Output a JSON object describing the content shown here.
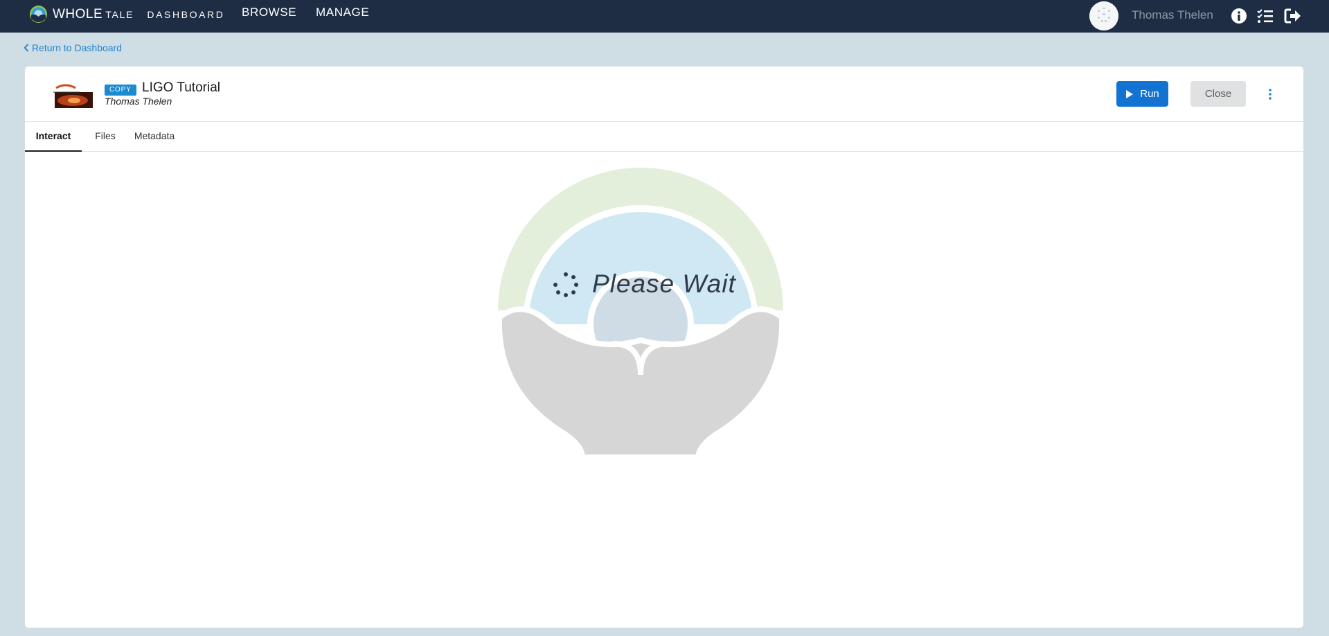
{
  "topbar": {
    "brand_whole": "WHOLE",
    "brand_tale": "TALE",
    "brand_dashboard": "DASHBOARD",
    "nav": [
      {
        "label": "BROWSE"
      },
      {
        "label": "MANAGE"
      }
    ],
    "username": "Thomas Thelen",
    "icons": [
      "info-icon",
      "tasks-icon",
      "logout-icon"
    ]
  },
  "return_link": {
    "label": "Return to Dashboard"
  },
  "tale": {
    "badge": "COPY",
    "title": "LIGO Tutorial",
    "author": "Thomas Thelen",
    "run_label": "Run",
    "close_label": "Close"
  },
  "tabs": [
    {
      "label": "Interact",
      "active": true
    },
    {
      "label": "Files",
      "active": false
    },
    {
      "label": "Metadata",
      "active": false
    }
  ],
  "loader": {
    "message": "Please Wait"
  },
  "colors": {
    "topbar": "#1f2d44",
    "page_bg": "#cfdde4",
    "link": "#2185d0",
    "run_button": "#1373d3",
    "badge": "#1b8acf"
  }
}
